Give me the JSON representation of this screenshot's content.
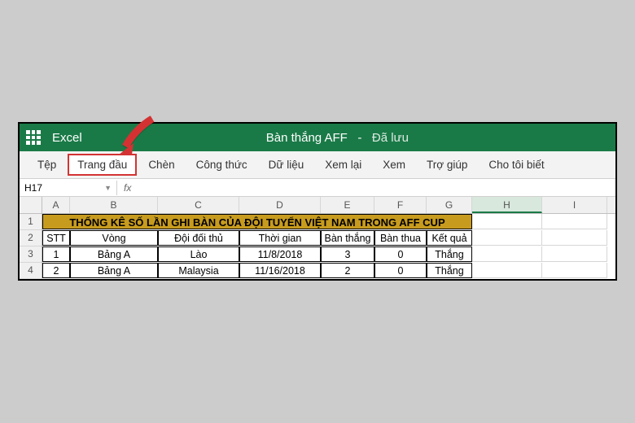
{
  "titlebar": {
    "app_name": "Excel",
    "document_title": "Bàn thắng AFF",
    "save_status": "Đã lưu",
    "separator": "-"
  },
  "ribbon": {
    "tabs": [
      "Tệp",
      "Trang đầu",
      "Chèn",
      "Công thức",
      "Dữ liệu",
      "Xem lại",
      "Xem",
      "Trợ giúp",
      "Cho tôi biết"
    ]
  },
  "formula_bar": {
    "cell_ref": "H17",
    "fx_label": "fx",
    "value": ""
  },
  "columns": [
    "A",
    "B",
    "C",
    "D",
    "E",
    "F",
    "G",
    "H",
    "I"
  ],
  "active_column": "H",
  "rows_visible": [
    1,
    2,
    3,
    4
  ],
  "sheet": {
    "title": "THỐNG KÊ SỐ LẦN GHI BÀN CỦA ĐỘI TUYỂN VIỆT NAM TRONG AFF CUP",
    "headers": [
      "STT",
      "Vòng",
      "Đội đối thủ",
      "Thời gian",
      "Bàn thắng",
      "Bàn thua",
      "Kết quả"
    ],
    "rows": [
      {
        "stt": "1",
        "vong": "Bảng A",
        "doi": "Lào",
        "tg": "11/8/2018",
        "bt": "3",
        "bth": "0",
        "kq": "Thắng"
      },
      {
        "stt": "2",
        "vong": "Bảng A",
        "doi": "Malaysia",
        "tg": "11/16/2018",
        "bt": "2",
        "bth": "0",
        "kq": "Thắng"
      }
    ]
  },
  "icons": {
    "apps": "apps-icon",
    "dropdown": "▼"
  }
}
